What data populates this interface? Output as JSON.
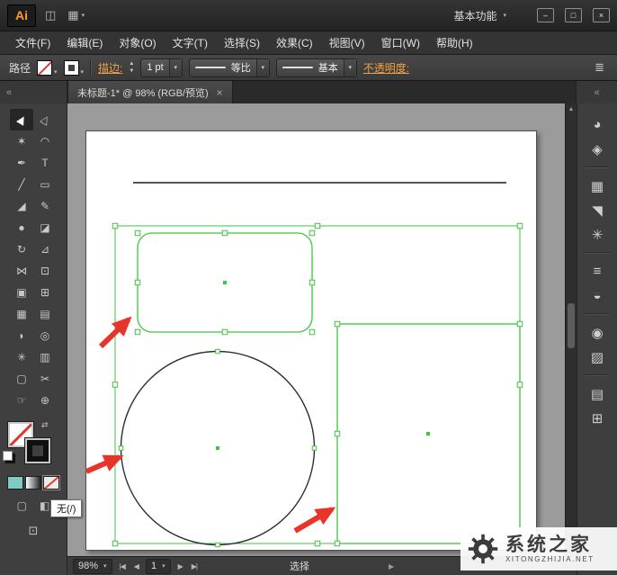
{
  "titlebar": {
    "logo": "Ai",
    "bridge_icon": "◫",
    "arrange_icon": "▦",
    "workspace": "基本功能",
    "minimize": "–",
    "maximize": "□",
    "close": "×"
  },
  "menubar": {
    "items": [
      "文件(F)",
      "编辑(E)",
      "对象(O)",
      "文字(T)",
      "选择(S)",
      "效果(C)",
      "视图(V)",
      "窗口(W)",
      "帮助(H)"
    ]
  },
  "controlbar": {
    "selection_label": "路径",
    "stroke_label": "描边:",
    "stroke_weight": "1 pt",
    "profile_value": "等比",
    "brush_value": "基本",
    "opacity_label": "不透明度:",
    "menu_icon": "≣"
  },
  "tabbar": {
    "title": "未标题-1* @ 98% (RGB/预览)",
    "close": "×"
  },
  "toolbar": {
    "tools": [
      {
        "name": "selection",
        "glyph": "▶"
      },
      {
        "name": "direct-selection",
        "glyph": "▷"
      },
      {
        "name": "magic-wand",
        "glyph": "✶"
      },
      {
        "name": "lasso",
        "glyph": "◠"
      },
      {
        "name": "pen",
        "glyph": "✒"
      },
      {
        "name": "type",
        "glyph": "T"
      },
      {
        "name": "line",
        "glyph": "╱"
      },
      {
        "name": "rectangle",
        "glyph": "▭"
      },
      {
        "name": "paintbrush",
        "glyph": "◢"
      },
      {
        "name": "pencil",
        "glyph": "✎"
      },
      {
        "name": "blob-brush",
        "glyph": "●"
      },
      {
        "name": "eraser",
        "glyph": "◪"
      },
      {
        "name": "rotate",
        "glyph": "↻"
      },
      {
        "name": "scale",
        "glyph": "⊿"
      },
      {
        "name": "width",
        "glyph": "⋈"
      },
      {
        "name": "free-transform",
        "glyph": "⊡"
      },
      {
        "name": "shape-builder",
        "glyph": "▣"
      },
      {
        "name": "perspective-grid",
        "glyph": "⊞"
      },
      {
        "name": "mesh",
        "glyph": "▦"
      },
      {
        "name": "gradient",
        "glyph": "▤"
      },
      {
        "name": "eyedropper",
        "glyph": "◗"
      },
      {
        "name": "blend",
        "glyph": "◎"
      },
      {
        "name": "symbol-sprayer",
        "glyph": "✳"
      },
      {
        "name": "column-graph",
        "glyph": "▥"
      },
      {
        "name": "artboard",
        "glyph": "▢"
      },
      {
        "name": "slice",
        "glyph": "✂"
      },
      {
        "name": "hand",
        "glyph": "☞"
      },
      {
        "name": "zoom",
        "glyph": "⊕"
      }
    ],
    "tooltip": "无(/)"
  },
  "dock": {
    "icons": [
      {
        "name": "color-panel",
        "glyph": "◕"
      },
      {
        "name": "color-guide",
        "glyph": "◈"
      },
      {
        "name": "swatches",
        "glyph": "▦"
      },
      {
        "name": "brushes",
        "glyph": "◥"
      },
      {
        "name": "symbols",
        "glyph": "✳"
      },
      {
        "name": "stroke-panel",
        "glyph": "≡"
      },
      {
        "name": "transparency",
        "glyph": "◒"
      },
      {
        "name": "appearance",
        "glyph": "◉"
      },
      {
        "name": "graphic-styles",
        "glyph": "▨"
      },
      {
        "name": "layers",
        "glyph": "▤"
      },
      {
        "name": "artboards",
        "glyph": "⊞"
      }
    ]
  },
  "statusbar": {
    "zoom": "98%",
    "nav_first": "|◀",
    "nav_prev": "◀",
    "artboard_number": "1",
    "nav_next": "▶",
    "nav_last": "▶|",
    "status": "选择",
    "scroll_right": "▶"
  },
  "watermark": {
    "title": "系统之家",
    "subtitle": "XITONGZHIJIA.NET"
  },
  "ui": {
    "caret": "▼",
    "caret_small": "▾",
    "step_up": "▲",
    "step_down": "▼",
    "chevrons": "«",
    "scroll_up": "▲",
    "scroll_down": "▼",
    "swap_icon": "⇄"
  },
  "colors": {
    "selection_green": "#3fc43f",
    "arrow_red": "#e8352b",
    "link_orange": "#f0a045",
    "logo_orange": "#ff9c2a"
  }
}
